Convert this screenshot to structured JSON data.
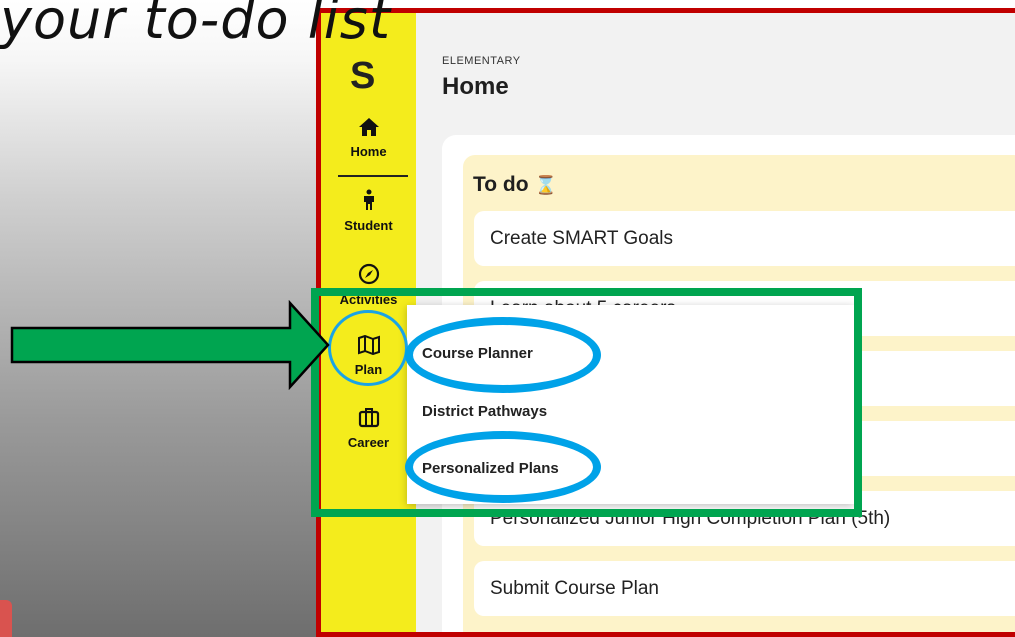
{
  "caption": "your to-do list",
  "sidebar": {
    "logo": "S",
    "items": [
      {
        "icon": "home-icon",
        "glyph": "⌂",
        "label": "Home"
      },
      {
        "icon": "student-icon",
        "glyph": "☨",
        "label": "Student"
      },
      {
        "icon": "compass-icon",
        "glyph": "⊘",
        "label": "Activities"
      },
      {
        "icon": "map-icon",
        "glyph": "⧉",
        "label": "Plan"
      },
      {
        "icon": "briefcase-icon",
        "glyph": "⎕",
        "label": "Career"
      }
    ]
  },
  "header": {
    "eyebrow": "ELEMENTARY",
    "title": "Home"
  },
  "todo": {
    "title": "To do",
    "icon": "hourglass-icon",
    "tasks": [
      "Create SMART Goals",
      "Learn about 5 careers",
      "Personalized Junior High Completion Plan (5th)",
      "Submit Course Plan"
    ]
  },
  "plan_menu": {
    "items": [
      "Course Planner",
      "District Pathways",
      "Personalized Plans"
    ]
  },
  "colors": {
    "sidebar": "#f4ec1c",
    "annotation_green": "#00a550",
    "annotation_blue": "#00a2e8",
    "frame_red": "#c00000",
    "todo_bg": "#fdf3c9"
  }
}
